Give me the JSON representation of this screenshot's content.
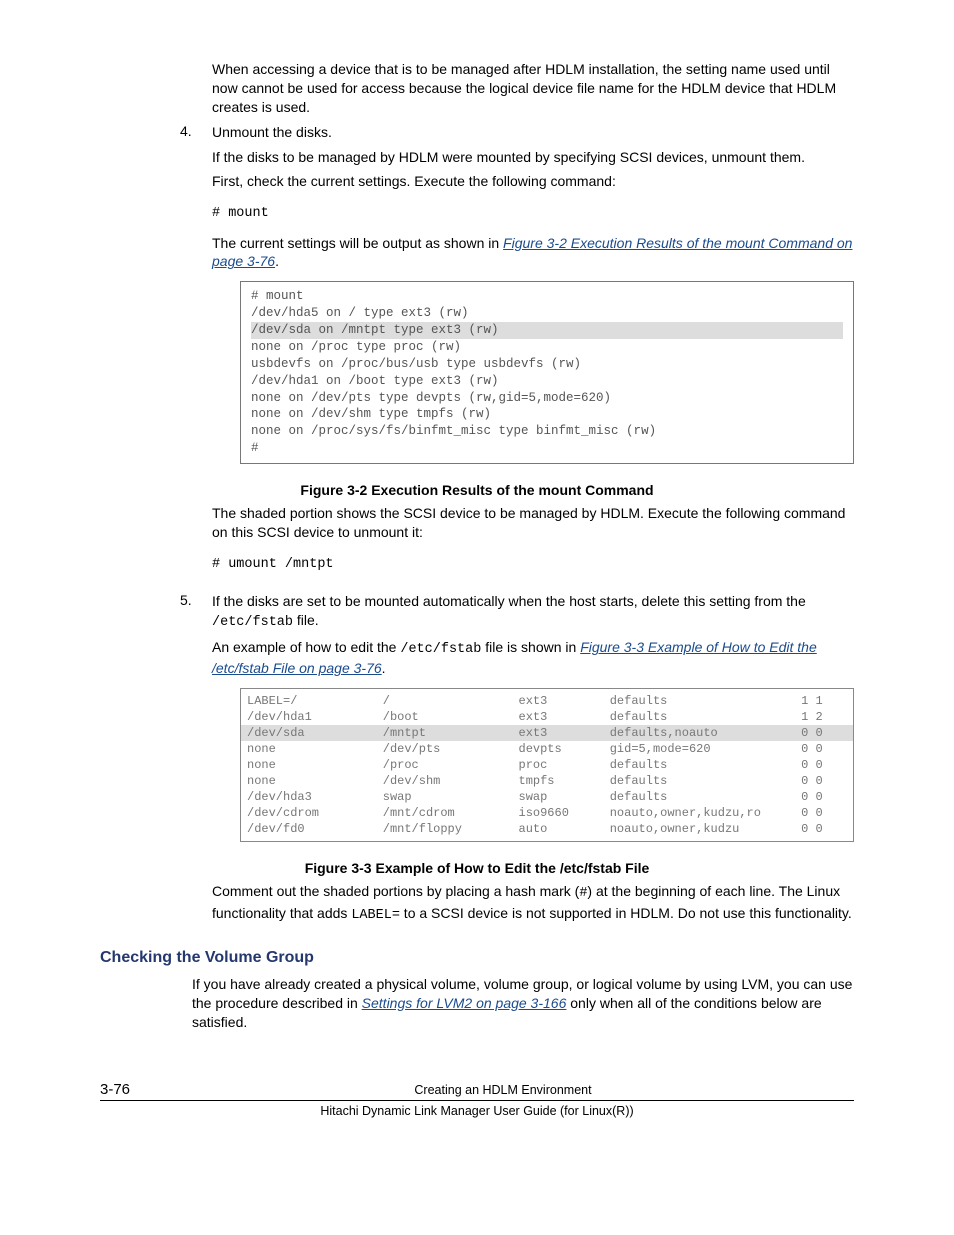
{
  "para_intro": "When accessing a device that is to be managed after HDLM installation, the setting name used until now cannot be used for access because the logical device file name for the HDLM device that HDLM creates is used.",
  "step4": {
    "num": "4.",
    "title": "Unmount the disks.",
    "p1": "If the disks to be managed by HDLM were mounted by specifying SCSI devices, unmount them.",
    "p2": "First, check the current settings. Execute the following command:",
    "cmd": "# mount",
    "p3a": "The current settings will be output as shown in ",
    "link1": "Figure 3-2 Execution Results of the mount Command on page 3-76",
    "p3b": "."
  },
  "fig32": {
    "lines": [
      "# mount",
      "/dev/hda5 on / type ext3 (rw)",
      "/dev/sda on /mntpt type ext3 (rw)",
      "none on /proc type proc (rw)",
      "usbdevfs on /proc/bus/usb type usbdevfs (rw)",
      "/dev/hda1 on /boot type ext3 (rw)",
      "none on /dev/pts type devpts (rw,gid=5,mode=620)",
      "none on /dev/shm type tmpfs (rw)",
      "none on /proc/sys/fs/binfmt_misc type binfmt_misc (rw)",
      "#"
    ],
    "shaded_index": 2,
    "caption": "Figure 3-2 Execution Results of the mount Command"
  },
  "after32": {
    "p1": "The shaded portion shows the SCSI device to be managed by HDLM. Execute the following command on this SCSI device to unmount it:",
    "cmd": "# umount /mntpt"
  },
  "step5": {
    "num": "5.",
    "p1a": "If the disks are set to be mounted automatically when the host starts, delete this setting from the ",
    "code1": "/etc/fstab",
    "p1b": " file.",
    "p2a": "An example of how to edit the ",
    "code2": "/etc/fstab",
    "p2b": " file is shown in ",
    "link": "Figure 3-3 Example of How to Edit the /etc/fstab File on page 3-76",
    "p2c": "."
  },
  "fig33": {
    "rows": [
      {
        "dev": "LABEL=/",
        "mnt": "/",
        "fs": "ext3",
        "opt": "defaults",
        "dump": "1 1",
        "shaded": false
      },
      {
        "dev": "/dev/hda1",
        "mnt": "/boot",
        "fs": "ext3",
        "opt": "defaults",
        "dump": "1 2",
        "shaded": false
      },
      {
        "dev": "/dev/sda",
        "mnt": "/mntpt",
        "fs": "ext3",
        "opt": "defaults,noauto",
        "dump": "0 0",
        "shaded": true
      },
      {
        "dev": "none",
        "mnt": "/dev/pts",
        "fs": "devpts",
        "opt": "gid=5,mode=620",
        "dump": "0 0",
        "shaded": false
      },
      {
        "dev": "none",
        "mnt": "/proc",
        "fs": "proc",
        "opt": "defaults",
        "dump": "0 0",
        "shaded": false
      },
      {
        "dev": "none",
        "mnt": "/dev/shm",
        "fs": "tmpfs",
        "opt": "defaults",
        "dump": "0 0",
        "shaded": false
      },
      {
        "dev": "/dev/hda3",
        "mnt": "swap",
        "fs": "swap",
        "opt": "defaults",
        "dump": "0 0",
        "shaded": false
      },
      {
        "dev": "/dev/cdrom",
        "mnt": "/mnt/cdrom",
        "fs": "iso9660",
        "opt": "noauto,owner,kudzu,ro",
        "dump": "0 0",
        "shaded": false
      },
      {
        "dev": "/dev/fd0",
        "mnt": "/mnt/floppy",
        "fs": "auto",
        "opt": "noauto,owner,kudzu",
        "dump": "0 0",
        "shaded": false
      }
    ],
    "caption": "Figure 3-3 Example of How to Edit the /etc/fstab File"
  },
  "after33": {
    "p1a": "Comment out the shaded portions by placing a hash mark (",
    "hash": "#",
    "p1b": ") at the beginning of each line. The Linux functionality that adds ",
    "label": "LABEL=",
    "p1c": " to a SCSI device is not supported in HDLM. Do not use this functionality."
  },
  "section": {
    "heading": "Checking the Volume Group",
    "p1a": "If you have already created a physical volume, volume group, or logical volume by using LVM, you can use the procedure described in ",
    "link": "Settings for LVM2 on page 3-166",
    "p1b": " only when all of the conditions below are satisfied."
  },
  "footer": {
    "pagenum": "3-76",
    "chapter": "Creating an HDLM Environment",
    "doc": "Hitachi Dynamic Link Manager User Guide (for Linux(R))"
  }
}
